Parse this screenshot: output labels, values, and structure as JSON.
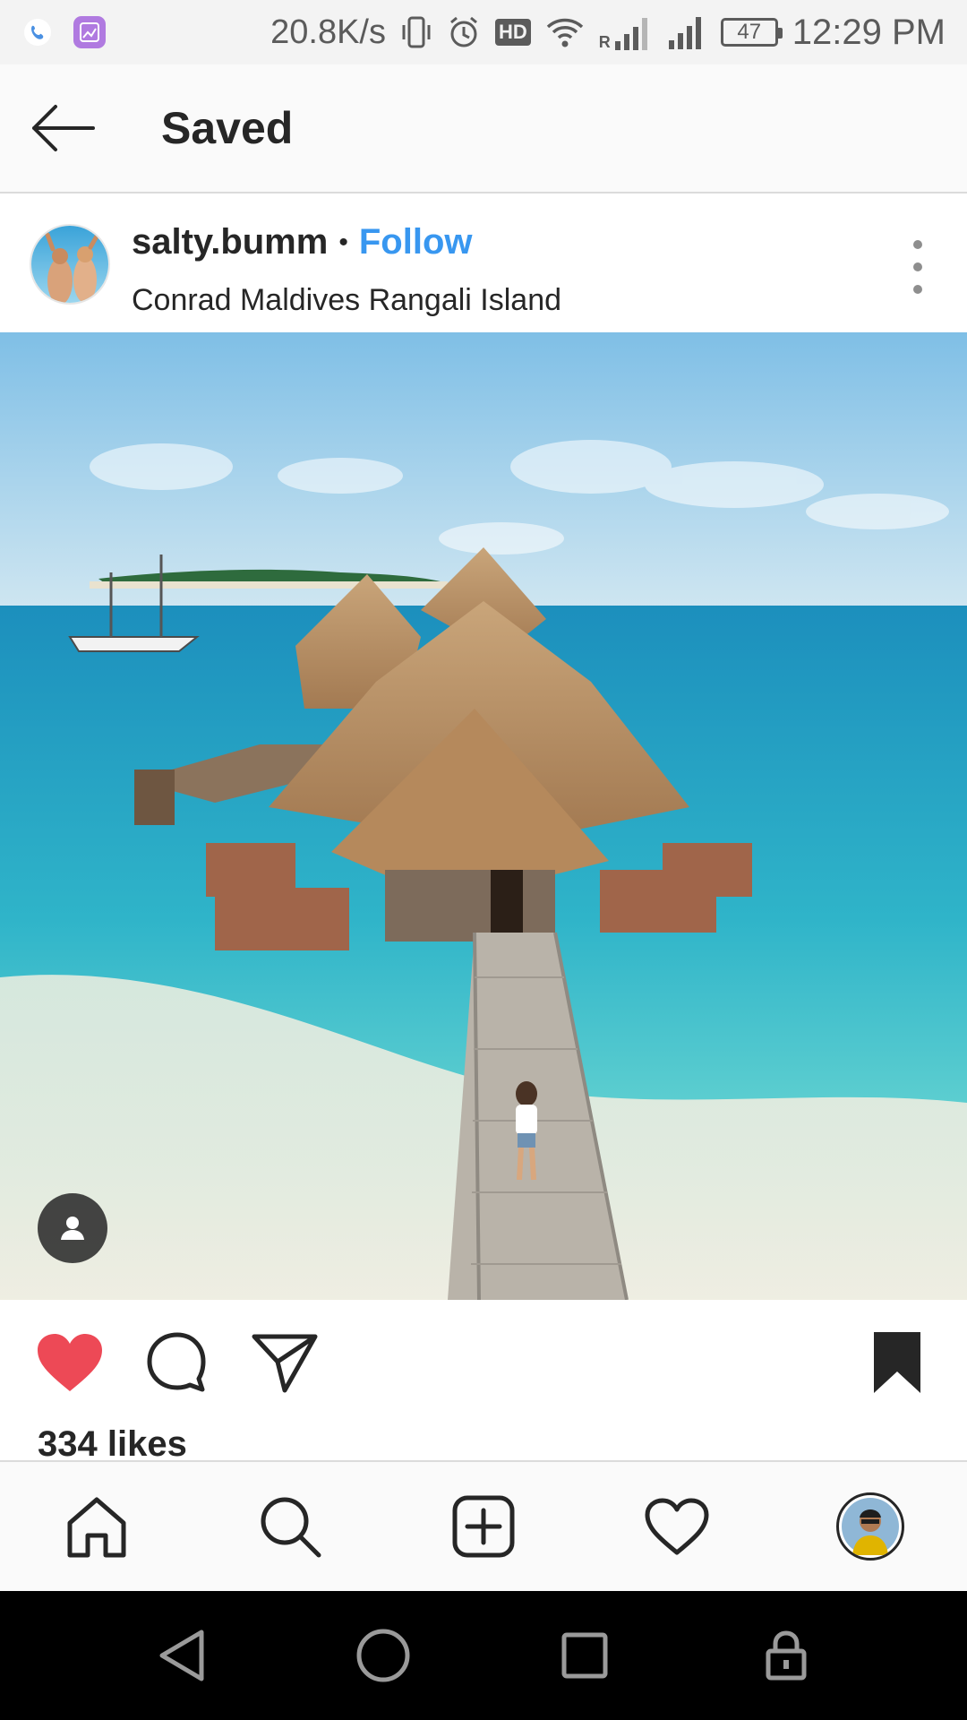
{
  "status_bar": {
    "network_speed": "20.8K/s",
    "battery": "47",
    "time": "12:29 PM",
    "hd_label": "HD",
    "roaming_label": "R"
  },
  "header": {
    "title": "Saved"
  },
  "post": {
    "username": "salty.bumm",
    "separator": "•",
    "follow_label": "Follow",
    "location": "Conrad Maldives Rangali Island",
    "liked": true,
    "saved": true,
    "likes_text": "334 likes"
  },
  "colors": {
    "like": "#ed4956",
    "follow": "#3897f0",
    "text": "#262626"
  },
  "icons": {
    "back": "arrow-left-icon",
    "more": "more-vertical-icon",
    "like": "heart-filled-icon",
    "comment": "comment-icon",
    "share": "paper-plane-icon",
    "save": "bookmark-filled-icon",
    "tag": "person-tag-icon",
    "home": "home-icon",
    "search": "search-icon",
    "create": "plus-square-icon",
    "activity": "heart-outline-icon",
    "back_system": "triangle-back-icon",
    "home_system": "circle-home-icon",
    "recents_system": "square-recents-icon",
    "lock_system": "lock-icon"
  }
}
